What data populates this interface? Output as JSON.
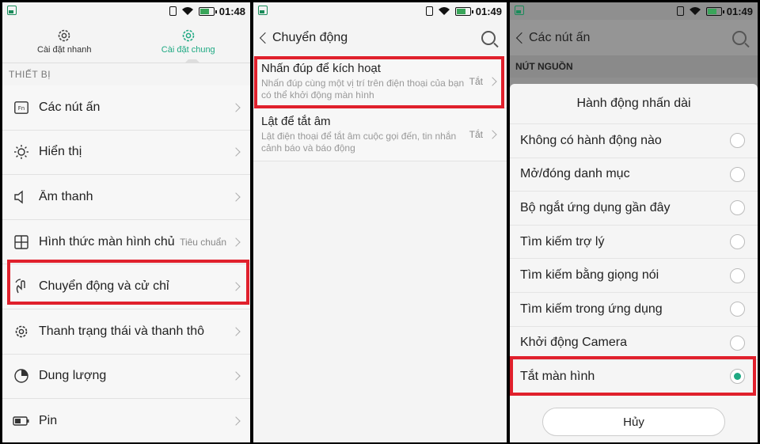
{
  "panel1": {
    "time": "01:48",
    "tabs": [
      {
        "label": "Cài đặt nhanh"
      },
      {
        "label": "Cài đặt chung"
      }
    ],
    "section": "THIẾT BỊ",
    "items": [
      {
        "label": "Các nút ấn",
        "value": "",
        "icon": "fn-icon"
      },
      {
        "label": "Hiển thị",
        "value": "",
        "icon": "brightness-icon"
      },
      {
        "label": "Âm thanh",
        "value": "",
        "icon": "speaker-icon"
      },
      {
        "label": "Hình thức màn hình chủ",
        "value": "Tiêu chuẩn",
        "icon": "home-screen-icon"
      },
      {
        "label": "Chuyển động và cử chỉ",
        "value": "",
        "icon": "gesture-icon"
      },
      {
        "label": "Thanh trạng thái và thanh thô",
        "value": "",
        "icon": "gear-icon"
      },
      {
        "label": "Dung lượng",
        "value": "",
        "icon": "storage-icon"
      },
      {
        "label": "Pin",
        "value": "",
        "icon": "battery-icon"
      }
    ]
  },
  "panel2": {
    "time": "01:49",
    "title": "Chuyển động",
    "items": [
      {
        "title": "Nhấn đúp để kích hoạt",
        "desc": "Nhấn đúp cùng một vị trí trên điện thoại của bạn có thể khởi động màn hình",
        "value": "Tắt"
      },
      {
        "title": "Lật để tắt âm",
        "desc": "Lật điện thoại để tắt âm cuộc gọi đến, tin nhắn cảnh báo và báo động",
        "value": "Tắt"
      }
    ]
  },
  "panel3": {
    "time": "01:49",
    "title": "Các nút ấn",
    "section": "NÚT NGUỒN",
    "sheet_title": "Hành động nhấn dài",
    "options": [
      {
        "label": "Không có hành động nào",
        "selected": false
      },
      {
        "label": "Mở/đóng danh mục",
        "selected": false
      },
      {
        "label": "Bộ ngắt ứng dụng gần đây",
        "selected": false
      },
      {
        "label": "Tìm kiếm trợ lý",
        "selected": false
      },
      {
        "label": "Tìm kiếm bằng giọng nói",
        "selected": false
      },
      {
        "label": "Tìm kiếm trong ứng dụng",
        "selected": false
      },
      {
        "label": "Khởi động Camera",
        "selected": false
      },
      {
        "label": "Tắt màn hình",
        "selected": true
      }
    ],
    "cancel_label": "Hủy"
  },
  "colors": {
    "accent": "#1fa983",
    "highlight": "#e0202c"
  }
}
